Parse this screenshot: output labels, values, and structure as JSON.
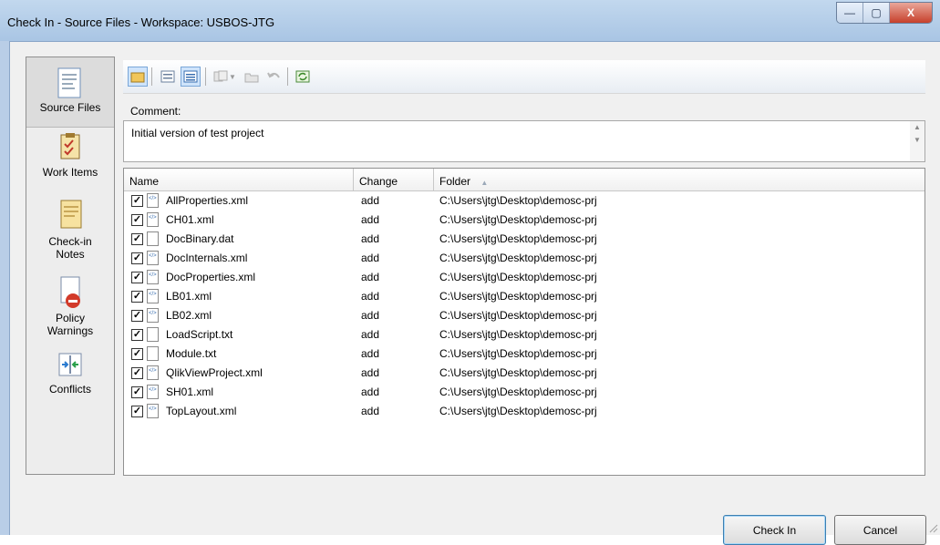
{
  "window": {
    "title": "Check In - Source Files - Workspace: USBOS-JTG",
    "controls": {
      "minimize": "—",
      "maximize": "▢",
      "close": "X"
    }
  },
  "sidebar": {
    "items": [
      {
        "label": "Source Files",
        "icon": "source-files-icon"
      },
      {
        "label": "Work Items",
        "icon": "work-items-icon"
      },
      {
        "label": "Check-in Notes",
        "icon": "checkin-notes-icon"
      },
      {
        "label": "Policy Warnings",
        "icon": "policy-warnings-icon"
      },
      {
        "label": "Conflicts",
        "icon": "conflicts-icon"
      }
    ]
  },
  "toolbar": {
    "icons": [
      "folder-view-icon",
      "flat-view-icon",
      "details-view-icon",
      "compare-icon",
      "open-folder-icon",
      "undo-icon",
      "refresh-icon"
    ]
  },
  "comment": {
    "label": "Comment:",
    "value": "Initial version of test project"
  },
  "table": {
    "columns": {
      "name": "Name",
      "change": "Change",
      "folder": "Folder",
      "sort_indicator": "▲"
    },
    "rows": [
      {
        "name": "AllProperties.xml",
        "change": "add",
        "folder": "C:\\Users\\jtg\\Desktop\\demosc-prj",
        "type": "xml",
        "checked": true
      },
      {
        "name": "CH01.xml",
        "change": "add",
        "folder": "C:\\Users\\jtg\\Desktop\\demosc-prj",
        "type": "xml",
        "checked": true
      },
      {
        "name": "DocBinary.dat",
        "change": "add",
        "folder": "C:\\Users\\jtg\\Desktop\\demosc-prj",
        "type": "file",
        "checked": true
      },
      {
        "name": "DocInternals.xml",
        "change": "add",
        "folder": "C:\\Users\\jtg\\Desktop\\demosc-prj",
        "type": "xml",
        "checked": true
      },
      {
        "name": "DocProperties.xml",
        "change": "add",
        "folder": "C:\\Users\\jtg\\Desktop\\demosc-prj",
        "type": "xml",
        "checked": true
      },
      {
        "name": "LB01.xml",
        "change": "add",
        "folder": "C:\\Users\\jtg\\Desktop\\demosc-prj",
        "type": "xml",
        "checked": true
      },
      {
        "name": "LB02.xml",
        "change": "add",
        "folder": "C:\\Users\\jtg\\Desktop\\demosc-prj",
        "type": "xml",
        "checked": true
      },
      {
        "name": "LoadScript.txt",
        "change": "add",
        "folder": "C:\\Users\\jtg\\Desktop\\demosc-prj",
        "type": "file",
        "checked": true
      },
      {
        "name": "Module.txt",
        "change": "add",
        "folder": "C:\\Users\\jtg\\Desktop\\demosc-prj",
        "type": "file",
        "checked": true
      },
      {
        "name": "QlikViewProject.xml",
        "change": "add",
        "folder": "C:\\Users\\jtg\\Desktop\\demosc-prj",
        "type": "xml",
        "checked": true
      },
      {
        "name": "SH01.xml",
        "change": "add",
        "folder": "C:\\Users\\jtg\\Desktop\\demosc-prj",
        "type": "xml",
        "checked": true
      },
      {
        "name": "TopLayout.xml",
        "change": "add",
        "folder": "C:\\Users\\jtg\\Desktop\\demosc-prj",
        "type": "xml",
        "checked": true
      }
    ]
  },
  "buttons": {
    "check_in": "Check In",
    "cancel": "Cancel"
  },
  "colors": {
    "titlebar": "#b4cde9",
    "selection": "#cfe4fb",
    "close": "#c7402c"
  }
}
